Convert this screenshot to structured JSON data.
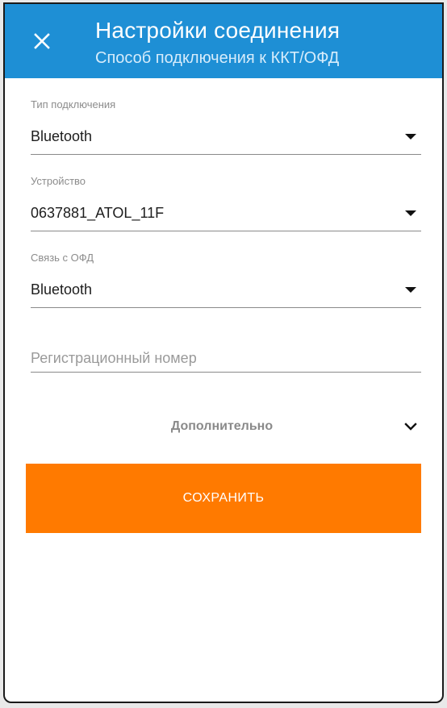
{
  "header": {
    "title": "Настройки соединения",
    "subtitle": "Способ подключения к ККТ/ОФД",
    "close_icon": "close-icon",
    "background_color": "#1e8fd5"
  },
  "form": {
    "connection_type": {
      "label": "Тип подключения",
      "value": "Bluetooth"
    },
    "device": {
      "label": "Устройство",
      "value": "0637881_ATOL_11F"
    },
    "ofd_link": {
      "label": "Связь с ОФД",
      "value": "Bluetooth"
    },
    "registration_number": {
      "value": "",
      "placeholder": "Регистрационный номер"
    },
    "advanced": {
      "label": "Дополнительно",
      "icon": "chevron-down-icon"
    }
  },
  "actions": {
    "save_label": "СОХРАНИТЬ",
    "save_color": "#ff7a00"
  }
}
